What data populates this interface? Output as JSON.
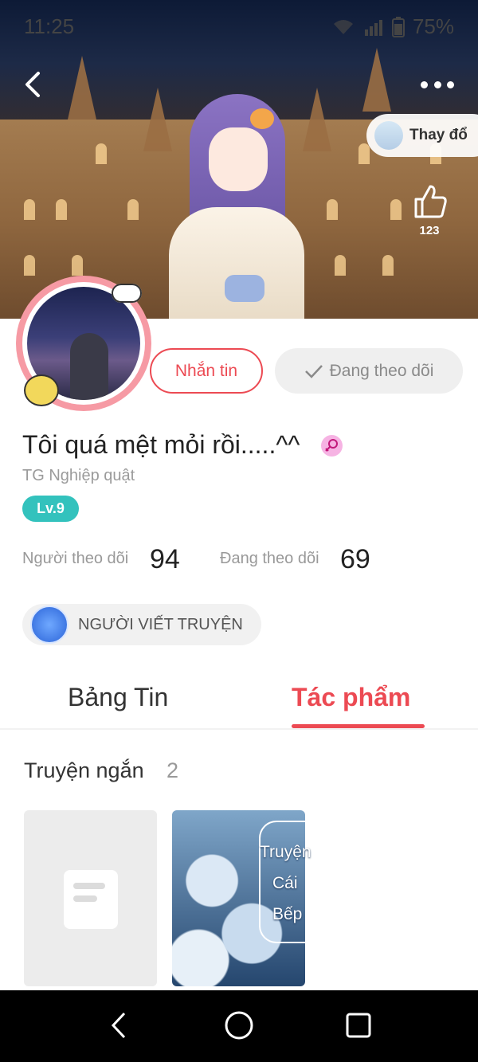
{
  "status_bar": {
    "time": "11:25",
    "battery": "75%"
  },
  "header": {
    "change_label": "Thay đổ",
    "likes": "123",
    "icons": [
      "back-arrow-icon",
      "more-dots-icon",
      "thumbs-up-icon"
    ]
  },
  "profile": {
    "name": "Tôi quá mệt mỏi rồi.....^^",
    "title": "TG Nghiệp quật",
    "level": "Lv.9",
    "followers_label": "Người theo dõi",
    "followers": "94",
    "following_label": "Đang theo dõi",
    "following": "69",
    "role": "NGƯỜI VIẾT TRUYỆN"
  },
  "actions": {
    "message": "Nhắn tin",
    "following_state": "Đang theo dõi"
  },
  "tabs": [
    {
      "label": "Bảng Tin",
      "active": false
    },
    {
      "label": "Tác phẩm",
      "active": true
    }
  ],
  "section": {
    "title": "Truyện ngắn",
    "count": "2",
    "cover_lines": [
      "Truyện",
      "Cái",
      "Bếp"
    ]
  },
  "colors": {
    "accent": "#ec4a53",
    "level_badge": "#33c2bd",
    "avatar_ring": "#f69aa4"
  }
}
